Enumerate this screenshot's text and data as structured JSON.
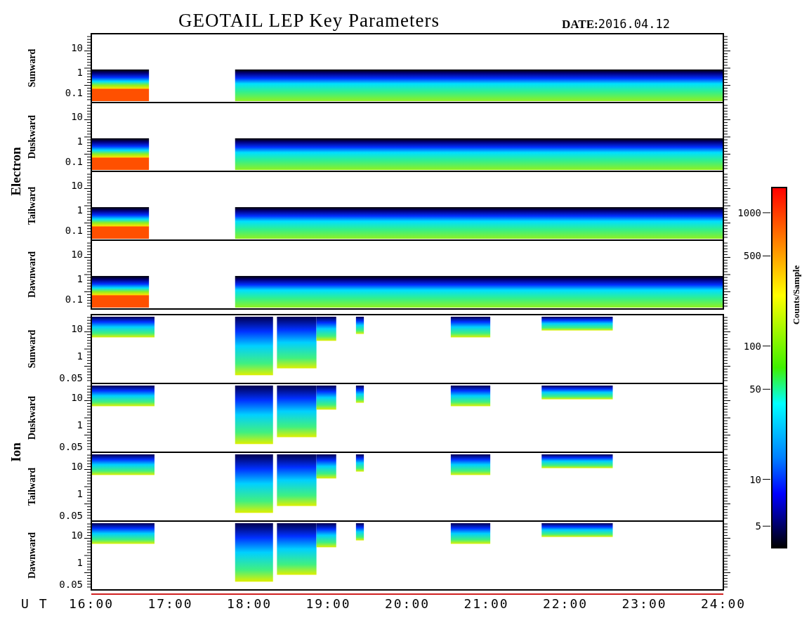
{
  "title": "GEOTAIL LEP Key Parameters",
  "date": {
    "label": "DATE:",
    "value": "2016.04.12"
  },
  "groups": [
    {
      "name": "Electron",
      "kind": "electron",
      "panels": [
        {
          "label": "Sunward",
          "yticks": [
            "10",
            "1",
            "0.1"
          ]
        },
        {
          "label": "Duskward",
          "yticks": [
            "10",
            "1",
            "0.1"
          ]
        },
        {
          "label": "Tailward",
          "yticks": [
            "10",
            "1",
            "0.1"
          ]
        },
        {
          "label": "Dawnward",
          "yticks": [
            "10",
            "1",
            "0.1"
          ]
        }
      ]
    },
    {
      "name": "Ion",
      "kind": "ion",
      "panels": [
        {
          "label": "Sunward",
          "yticks": [
            "10",
            "1",
            "0.05"
          ]
        },
        {
          "label": "Duskward",
          "yticks": [
            "10",
            "1",
            "0.05"
          ]
        },
        {
          "label": "Tailward",
          "yticks": [
            "10",
            "1",
            "0.05"
          ]
        },
        {
          "label": "Dawnward",
          "yticks": [
            "10",
            "1",
            "0.05"
          ]
        }
      ]
    }
  ],
  "time_axis": {
    "label": "U T",
    "ticks": [
      "16:00",
      "17:00",
      "18:00",
      "19:00",
      "20:00",
      "21:00",
      "22:00",
      "23:00",
      "24:00"
    ]
  },
  "colorbar": {
    "title": "Counts/Sample",
    "ticks": [
      "1000",
      "500",
      "100",
      "50",
      "10",
      "5"
    ]
  }
}
